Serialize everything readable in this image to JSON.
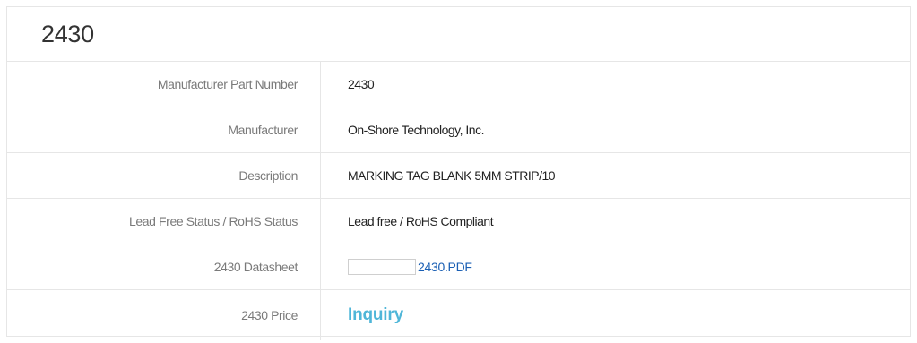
{
  "title": "2430",
  "rows": [
    {
      "label": "Manufacturer Part Number",
      "value": "2430"
    },
    {
      "label": "Manufacturer",
      "value": "On-Shore Technology, Inc."
    },
    {
      "label": "Description",
      "value": "MARKING TAG BLANK 5MM STRIP/10"
    },
    {
      "label": "Lead Free Status / RoHS Status",
      "value": "Lead free / RoHS Compliant"
    }
  ],
  "datasheet": {
    "label": "2430 Datasheet",
    "link_text": "2430.PDF"
  },
  "price": {
    "label": "2430 Price",
    "link_text": "Inquiry"
  },
  "colors": {
    "border": "#e6e6e6",
    "label_text": "#7a7a7a",
    "link": "#1a5fb4",
    "inquiry": "#4fb6d8"
  }
}
